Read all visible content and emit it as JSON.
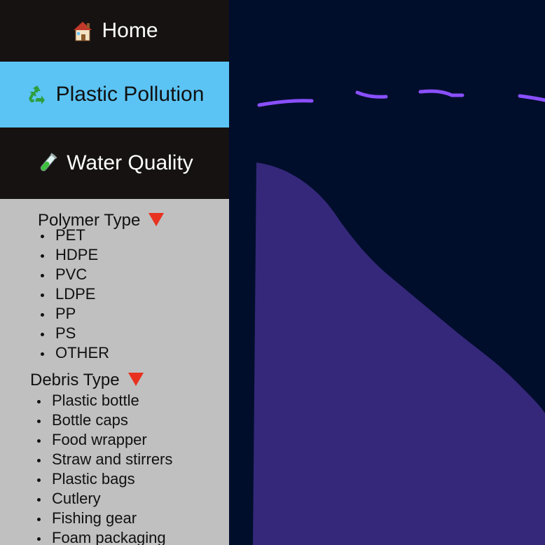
{
  "nav": {
    "home": {
      "label": "Home",
      "icon": "house-icon"
    },
    "plastic": {
      "label": "Plastic Pollution",
      "icon": "recycle-icon"
    },
    "water": {
      "label": "Water Quality",
      "icon": "test-tube-icon"
    }
  },
  "filters": {
    "polymer": {
      "title": "Polymer Type",
      "items": [
        "PET",
        "HDPE",
        "PVC",
        "LDPE",
        "PP",
        "PS",
        "OTHER"
      ]
    },
    "debris": {
      "title": "Debris Type",
      "items": [
        "Plastic bottle",
        "Bottle caps",
        "Food wrapper",
        "Straw and stirrers",
        "Plastic bags",
        "Cutlery",
        "Fishing gear",
        "Foam packaging"
      ]
    }
  },
  "colors": {
    "sidebar_bg": "#c0c0c0",
    "nav_dark": "#161212",
    "nav_active": "#5bc4f5",
    "chart_bg": "#000e2b",
    "area_fill": "#35287a",
    "dash_line": "#8a4fff",
    "dropdown_arrow": "#e8321f"
  }
}
